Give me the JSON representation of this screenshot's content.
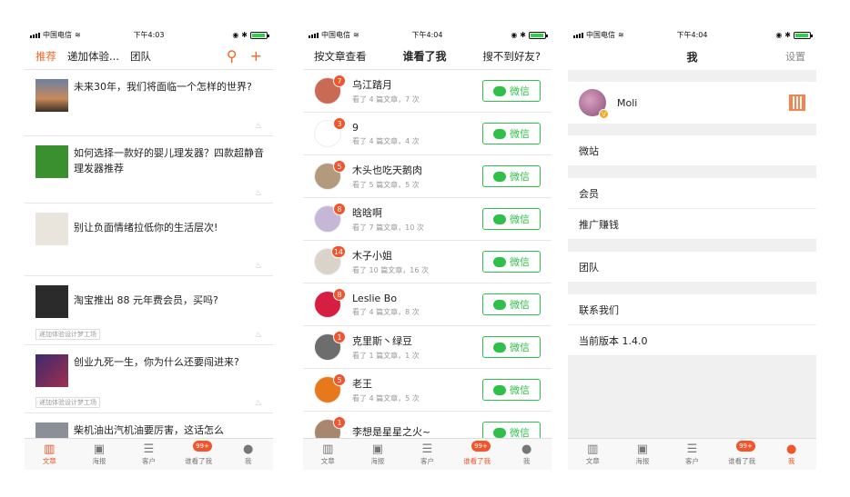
{
  "status": {
    "carrier": "中国电信",
    "battery_color": "#2bd34a",
    "time1": "下午4:03",
    "time2": "下午4:04",
    "time3": "下午4:04"
  },
  "tabbar": {
    "items": [
      {
        "label": "文章",
        "icon": "bar-chart-icon"
      },
      {
        "label": "海报",
        "icon": "image-icon"
      },
      {
        "label": "客户",
        "icon": "list-icon"
      },
      {
        "label": "谁看了我",
        "icon": "eye-icon",
        "badge": "99+"
      },
      {
        "label": "我",
        "icon": "person-icon"
      }
    ]
  },
  "screen1": {
    "tabs": [
      "推荐",
      "递加体验...",
      "团队"
    ],
    "articles": [
      {
        "title": "未来30年，我们将面临一个怎样的世界?",
        "tag": ""
      },
      {
        "title": "如何选择一款好的婴儿理发器？四款超静音理发器推荐",
        "tag": ""
      },
      {
        "title": "别让负面情绪拉低你的生活层次!",
        "tag": ""
      },
      {
        "title": "淘宝推出 88 元年费会员，买吗?",
        "tag": "递加体验设计梦工场"
      },
      {
        "title": "创业九死一生，你为什么还要闯进来?",
        "tag": "递加体验设计梦工场"
      },
      {
        "title": "柴机油出汽机油要厉害，这话怎么",
        "tag": ""
      }
    ]
  },
  "screen2": {
    "left": "按文章查看",
    "title": "谁看了我",
    "right": "搜不到好友?",
    "wechat_label": "微信",
    "viewers": [
      {
        "name": "乌江踏月",
        "badge": "7",
        "sub": "看了 4 篇文章，7 次",
        "color": "#c96a55"
      },
      {
        "name": "9",
        "badge": "3",
        "sub": "看了 4 篇文章，4 次",
        "color": "#ffffff"
      },
      {
        "name": "木头也吃天鹅肉",
        "badge": "5",
        "sub": "看了 5 篇文章，5 次",
        "color": "#b39a7c"
      },
      {
        "name": "晗晗啊",
        "badge": "8",
        "sub": "看了 7 篇文章，10 次",
        "color": "#c7b7d6"
      },
      {
        "name": "木子小姐",
        "badge": "14",
        "sub": "看了 10 篇文章，16 次",
        "color": "#d9d3c9"
      },
      {
        "name": "Leslie Bo",
        "badge": "8",
        "sub": "看了 4 篇文章，8 次",
        "color": "#d61e42"
      },
      {
        "name": "克里斯丶绿豆",
        "badge": "1",
        "sub": "看了 1 篇文章，1 次",
        "color": "#6d6d6d"
      },
      {
        "name": "老王",
        "badge": "5",
        "sub": "看了 4 篇文章，5 次",
        "color": "#e8781c"
      },
      {
        "name": "李想是星星之火~",
        "badge": "1",
        "sub": "",
        "color": "#a8866f"
      }
    ]
  },
  "screen3": {
    "title": "我",
    "right": "设置",
    "profile_name": "Moli",
    "menu": [
      "微站",
      "会员",
      "推广赚钱",
      "团队",
      "联系我们",
      "当前版本 1.4.0"
    ]
  }
}
